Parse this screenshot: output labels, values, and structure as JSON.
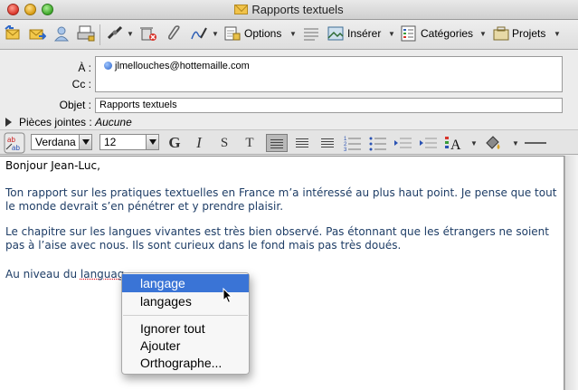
{
  "window": {
    "title": "Rapports textuels"
  },
  "toolbar": {
    "icons": [
      "reply-icon",
      "forward-icon",
      "contacts-icon",
      "print-icon",
      "delete-icon",
      "attach-icon",
      "signature-icon",
      "options-icon",
      "insert-icon",
      "categories-icon",
      "projects-icon"
    ],
    "options_label": "Options",
    "insert_label": "Insérer",
    "categories_label": "Catégories",
    "projects_label": "Projets"
  },
  "header": {
    "to_label": "À :",
    "to_value": "jlmellouches@hottemaille.com",
    "cc_label": "Cc :",
    "subject_label": "Objet :",
    "subject_value": "Rapports textuels",
    "attachments_label": "Pièces jointes :",
    "attachments_value": "Aucune"
  },
  "format": {
    "font_value": "Verdana",
    "size_value": "12",
    "bold_label": "G",
    "italic_label": "I",
    "strike_label": "S",
    "teletype_label": "T"
  },
  "body": {
    "greeting": "Bonjour Jean-Luc,",
    "para1": "Ton rapport sur les pratiques textuelles en France m’a intéressé au plus haut point. Je pense que tout le monde devrait s’en pénétrer et y prendre plaisir.",
    "para2": "Le chapitre sur les langues vivantes est très bien observé. Pas étonnant que les étrangers ne soient pas à l’aise avec nous. Ils sont curieux dans le fond mais pas très doués.",
    "para3_prefix": "Au niveau du ",
    "para3_word": "languag"
  },
  "context_menu": {
    "items": [
      {
        "label": "langage"
      },
      {
        "label": "langages"
      },
      {
        "label": "Ignorer tout"
      },
      {
        "label": "Ajouter"
      },
      {
        "label": "Orthographe..."
      }
    ],
    "highlighted_index": 0
  },
  "colors": {
    "highlight": "#3a74d6",
    "body_blue_text": "#1e3d66"
  }
}
